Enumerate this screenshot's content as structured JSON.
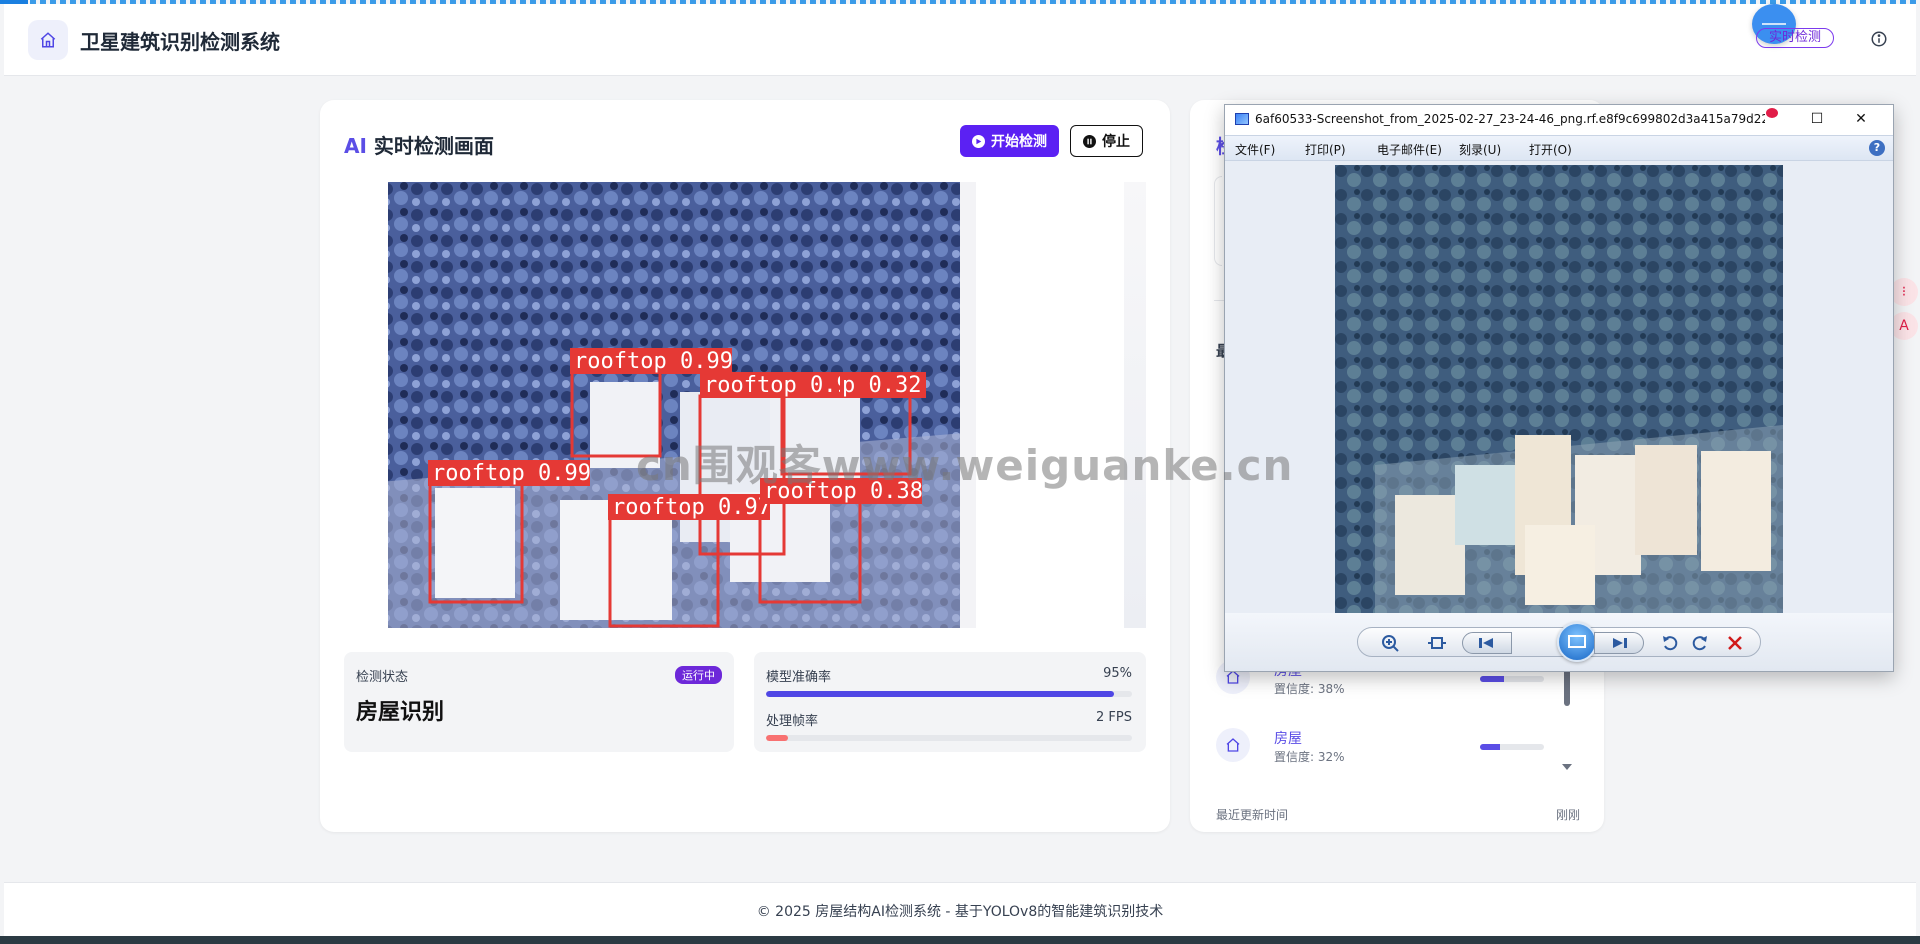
{
  "header": {
    "app_title": "卫星建筑识别检测系统",
    "realtime_pill": "实时检测"
  },
  "left_panel": {
    "title_ai": "AI",
    "title_rest": " 实时检测画面",
    "start_button": "开始检测",
    "stop_button": "停止",
    "video_detections": [
      {
        "label": "rooftop 0.99"
      },
      {
        "label": "rooftop 0.93"
      },
      {
        "label": "p 0.32"
      },
      {
        "label": "rooftop 0.99"
      },
      {
        "label": "rooftop 0.97"
      },
      {
        "label": "rooftop 0.38"
      }
    ],
    "status": {
      "label": "检测状态",
      "badge": "运行中",
      "value": "房屋识别"
    },
    "metrics": [
      {
        "name": "模型准确率",
        "value_text": "95%",
        "fill": 0.95,
        "color": "#4f46e5"
      },
      {
        "name": "处理帧率",
        "value_text": "2 FPS",
        "fill": 0.06,
        "color": "#f87171"
      }
    ]
  },
  "right_panel": {
    "title_initial": "检",
    "subtitle_initial": "最",
    "detections": [
      {
        "name": "房屋",
        "confidence": "置信度: 38%",
        "fill": 0.38
      },
      {
        "name": "房屋",
        "confidence": "置信度: 32%",
        "fill": 0.32
      }
    ],
    "footer_label": "最近更新时间",
    "footer_value": "刚刚"
  },
  "viewer": {
    "title": "6af60533-Screenshot_from_2025-02-27_23-24-46_png.rf.e8f9c699802d3a415a79d22...",
    "menus": [
      "文件(F)",
      "打印(P)",
      "电子邮件(E)",
      "刻录(U)",
      "打开(O)"
    ],
    "help": "?"
  },
  "watermark": "cn围观客www.weiguanke.cn",
  "footer": {
    "text": "© 2025 房屋结构AI检测系统 - 基于YOLOv8的智能建筑识别技术"
  },
  "colors": {
    "accent": "#5b21f3",
    "brand": "#5b4ee6",
    "bbox": "#e53935"
  },
  "icons": [
    "home-icon",
    "info-icon",
    "play-icon",
    "pause-icon",
    "zoom-icon",
    "fit-icon",
    "prev-icon",
    "slideshow-icon",
    "next-icon",
    "rotate-left-icon",
    "rotate-right-icon",
    "delete-icon"
  ]
}
